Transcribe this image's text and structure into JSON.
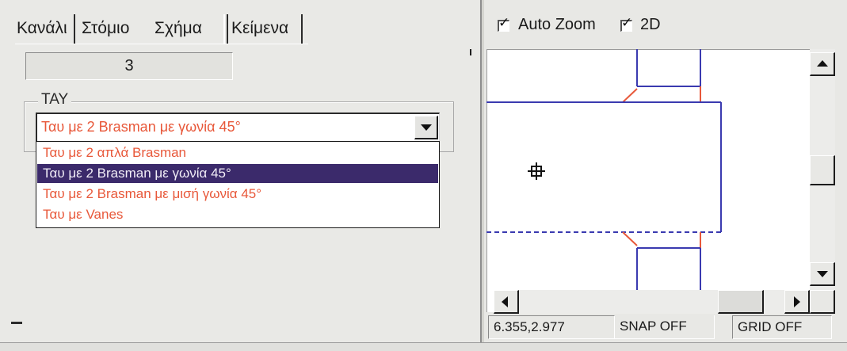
{
  "tabs": [
    {
      "label": "Κανάλι"
    },
    {
      "label": "Στόμιο"
    },
    {
      "label": "Σχήμα"
    },
    {
      "label": "Κείμενα"
    }
  ],
  "value_field": "3",
  "group": {
    "label": "TAY",
    "combo_value": "Ταυ με 2 Brasman με γωνία 45°",
    "options": [
      "Ταυ με 2 απλά Brasman",
      "Ταυ με 2 Brasman με γωνία 45°",
      "Ταυ με 2 Brasman με μισή γωνία 45°",
      "Ταυ με Vanes"
    ],
    "selected_index": 1
  },
  "toolbar": {
    "auto_zoom": {
      "label": "Auto Zoom",
      "checked": true
    },
    "two_d": {
      "label": "2D",
      "checked": true
    }
  },
  "status": {
    "coords": "6.355,2.977",
    "snap": "SNAP OFF",
    "grid": "GRID OFF"
  },
  "colors": {
    "option_text": "#e8583a",
    "selected_bg": "#3b2a6b",
    "drawing_line": "#3a3ab0",
    "drawing_accent": "#e8583a"
  },
  "icons": {
    "checkbox_mark": "✓",
    "crosshair": "crosshair-icon"
  }
}
